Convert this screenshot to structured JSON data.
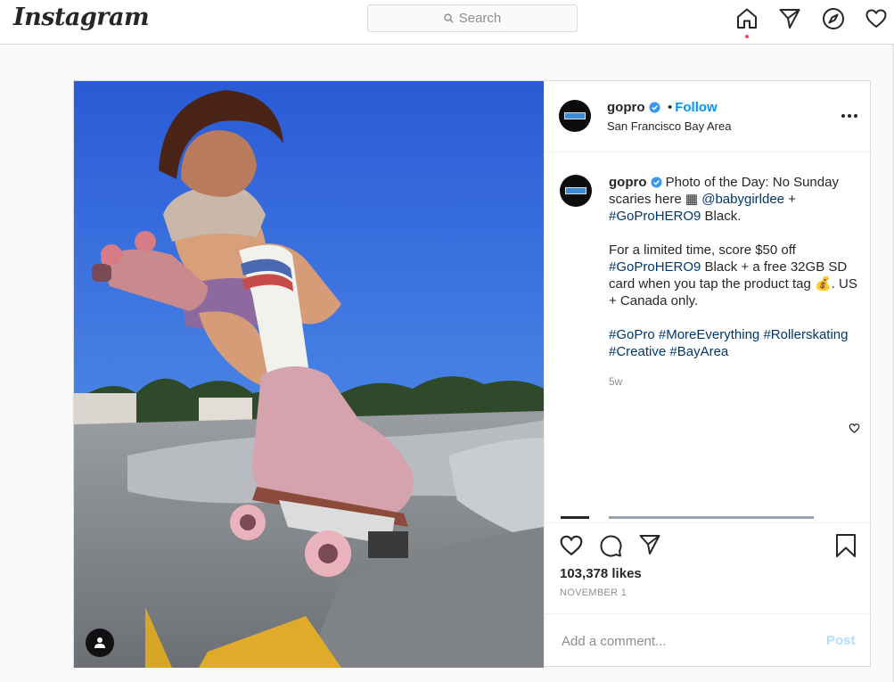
{
  "nav": {
    "logo": "Instagram",
    "search_placeholder": "Search",
    "icons": [
      "home-icon",
      "direct-icon",
      "explore-icon",
      "activity-icon"
    ],
    "accent": "#0095f6",
    "notification_color": "#ed4956"
  },
  "post": {
    "username": "gopro",
    "separator": "•",
    "follow_label": "Follow",
    "location": "San Francisco Bay Area",
    "caption": {
      "author": "gopro",
      "line1_text": " Photo of the Day: No Sunday scaries here ",
      "stack_emoji": "▦",
      "mention": "@babygirldee",
      "plus": " + ",
      "hashtag_hero9": "#GoProHERO9",
      "line1_tail": " Black.",
      "para2_a": "For a limited time, score $50 off ",
      "para2_hashtag": "#GoProHERO9",
      "para2_b": " Black + a free 32GB SD card when you tap the product tag ",
      "money_emoji": "💰",
      "para2_c": ". US + Canada only.",
      "hashtags": [
        "#GoPro",
        "#MoreEverything",
        "#Rollerskating",
        "#Creative",
        "#BayArea"
      ]
    },
    "age": "5w",
    "likes": "103,378 likes",
    "date": "NOVEMBER 1",
    "comment_placeholder": "Add a comment...",
    "post_label": "Post"
  }
}
